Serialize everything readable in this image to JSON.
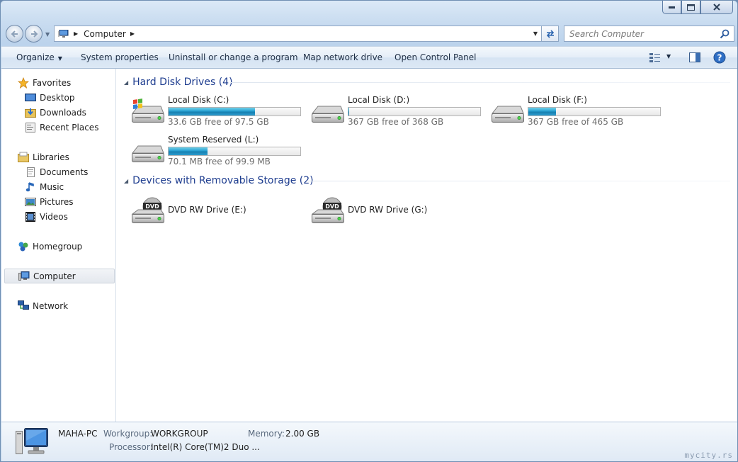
{
  "window": {
    "caption_buttons": [
      "minimize",
      "maximize",
      "close"
    ]
  },
  "address": {
    "crumb": "Computer",
    "search_placeholder": "Search Computer"
  },
  "toolbar": {
    "organize": "Organize",
    "system_properties": "System properties",
    "uninstall": "Uninstall or change a program",
    "map_drive": "Map network drive",
    "control_panel": "Open Control Panel"
  },
  "sidebar": {
    "favorites": "Favorites",
    "desktop": "Desktop",
    "downloads": "Downloads",
    "recent": "Recent Places",
    "libraries": "Libraries",
    "documents": "Documents",
    "music": "Music",
    "pictures": "Pictures",
    "videos": "Videos",
    "homegroup": "Homegroup",
    "computer": "Computer",
    "network": "Network",
    "selected": "Computer"
  },
  "groups": {
    "hard_disks": "Hard Disk Drives (4)",
    "removable": "Devices with Removable Storage (2)"
  },
  "drives": [
    {
      "name": "Local Disk (C:)",
      "free": "33.6 GB free of 97.5 GB",
      "used_fraction": 0.655,
      "windows": true
    },
    {
      "name": "Local Disk (D:)",
      "free": "367 GB free of 368 GB",
      "used_fraction": 0.003,
      "windows": false
    },
    {
      "name": "Local Disk (F:)",
      "free": "367 GB free of 465 GB",
      "used_fraction": 0.21,
      "windows": false
    },
    {
      "name": "System Reserved (L:)",
      "free": "70.1 MB free of 99.9 MB",
      "used_fraction": 0.298,
      "windows": false
    }
  ],
  "dvd_drives": [
    {
      "name": "DVD RW Drive (E:)",
      "badge": "DVD"
    },
    {
      "name": "DVD RW Drive (G:)",
      "badge": "DVD"
    }
  ],
  "details": {
    "pc_name": "MAHA-PC",
    "workgroup_label": "Workgroup:",
    "workgroup": "WORKGROUP",
    "memory_label": "Memory:",
    "memory": "2.00 GB",
    "processor_label": "Processor:",
    "processor": "Intel(R) Core(TM)2 Duo ..."
  },
  "watermark": "mycity.rs",
  "colors": {
    "progress": "#26a0d2",
    "group_title": "#1e3d8f",
    "toolbar_bg": "#dce8f5"
  }
}
